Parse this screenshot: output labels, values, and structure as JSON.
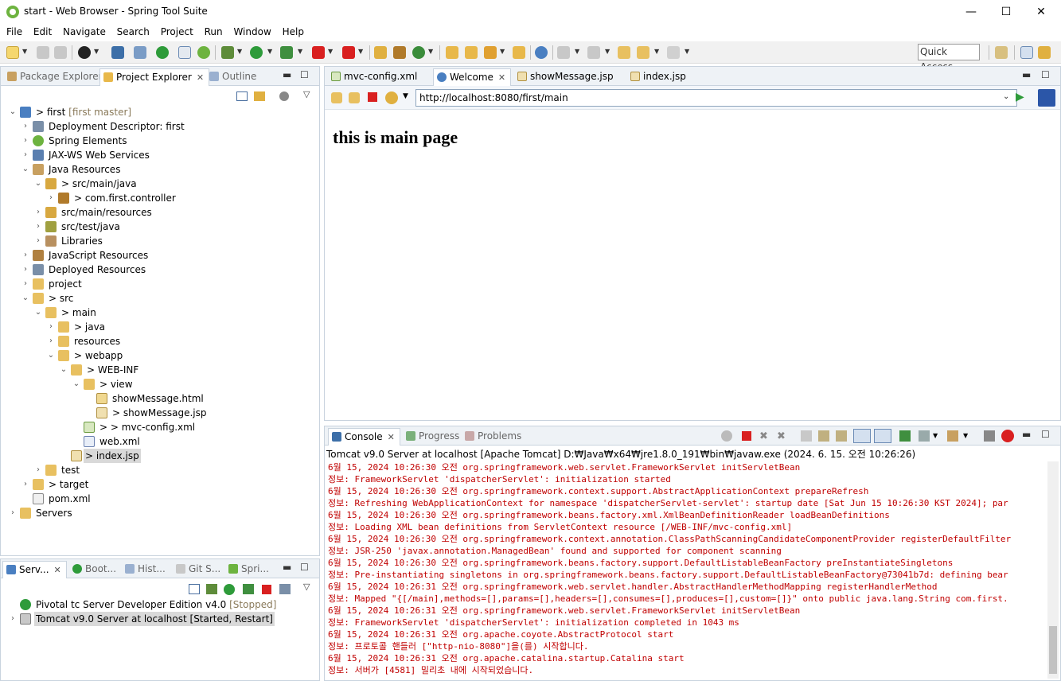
{
  "window": {
    "title": "start - Web Browser - Spring Tool Suite",
    "minimize": "—",
    "maximize": "☐",
    "close": "✕"
  },
  "menu": [
    "File",
    "Edit",
    "Navigate",
    "Search",
    "Project",
    "Run",
    "Window",
    "Help"
  ],
  "toolbar": {
    "quick_access_placeholder": "Quick Access"
  },
  "explorer": {
    "tabs": [
      {
        "label": "Package Explorer"
      },
      {
        "label": "Project Explorer",
        "close": "✕"
      },
      {
        "label": "Outline"
      }
    ],
    "tree": [
      {
        "twisty": "⌄",
        "prefix": "> ",
        "label": "first",
        "suffix": "[first master]"
      },
      {
        "twisty": "›",
        "label": "Deployment Descriptor: first"
      },
      {
        "twisty": "›",
        "label": "Spring Elements"
      },
      {
        "twisty": "›",
        "label": "JAX-WS Web Services"
      },
      {
        "twisty": "⌄",
        "label": "Java Resources"
      },
      {
        "twisty": "⌄",
        "prefix": "> ",
        "label": "src/main/java"
      },
      {
        "twisty": "›",
        "prefix": "> ",
        "label": "com.first.controller"
      },
      {
        "twisty": "›",
        "label": "src/main/resources"
      },
      {
        "twisty": "›",
        "label": "src/test/java"
      },
      {
        "twisty": "›",
        "label": "Libraries"
      },
      {
        "twisty": "›",
        "label": "JavaScript Resources"
      },
      {
        "twisty": "›",
        "label": "Deployed Resources"
      },
      {
        "twisty": "›",
        "label": "project"
      },
      {
        "twisty": "⌄",
        "prefix": "> ",
        "label": "src"
      },
      {
        "twisty": "⌄",
        "prefix": "> ",
        "label": "main"
      },
      {
        "twisty": "›",
        "prefix": "> ",
        "label": "java"
      },
      {
        "twisty": "›",
        "label": "resources"
      },
      {
        "twisty": "⌄",
        "prefix": "> ",
        "label": "webapp"
      },
      {
        "twisty": "⌄",
        "prefix": "> ",
        "label": "WEB-INF"
      },
      {
        "twisty": "⌄",
        "prefix": "> ",
        "label": "view"
      },
      {
        "twisty": "",
        "label": "showMessage.html"
      },
      {
        "twisty": "",
        "prefix": "> ",
        "label": "showMessage.jsp"
      },
      {
        "twisty": "",
        "prefix": "> > ",
        "label": "mvc-config.xml"
      },
      {
        "twisty": "",
        "label": "web.xml"
      },
      {
        "twisty": "",
        "prefix": "> ",
        "label": "index.jsp"
      },
      {
        "twisty": "›",
        "label": "test"
      },
      {
        "twisty": "›",
        "prefix": "> ",
        "label": "target"
      },
      {
        "twisty": "",
        "label": "pom.xml"
      },
      {
        "twisty": "›",
        "label": "Servers"
      }
    ]
  },
  "servers": {
    "tabs": [
      {
        "label": "Serv...",
        "close": "✕"
      },
      {
        "label": "Boot..."
      },
      {
        "label": "Hist..."
      },
      {
        "label": "Git S..."
      },
      {
        "label": "Spri..."
      }
    ],
    "items": [
      {
        "label": "Pivotal tc Server Developer Edition v4.0",
        "status": "[Stopped]"
      },
      {
        "twisty": "›",
        "label": "Tomcat v9.0 Server at localhost  [Started, Restart]"
      }
    ]
  },
  "editor": {
    "tabs": [
      {
        "label": "mvc-config.xml"
      },
      {
        "label": "Welcome",
        "close": "✕"
      },
      {
        "label": "showMessage.jsp"
      },
      {
        "label": "index.jsp"
      }
    ],
    "browser": {
      "url": "http://localhost:8080/first/main",
      "heading": "this is main page"
    }
  },
  "console": {
    "tabs": [
      {
        "label": "Console",
        "close": "✕"
      },
      {
        "label": "Progress"
      },
      {
        "label": "Problems"
      }
    ],
    "caption": "Tomcat v9.0 Server at localhost [Apache Tomcat] D:₩Java₩x64₩jre1.8.0_191₩bin₩javaw.exe (2024. 6. 15. 오전 10:26:26)",
    "lines": [
      "6월 15, 2024 10:26:30 오전 org.springframework.web.servlet.FrameworkServlet initServletBean",
      "정보: FrameworkServlet 'dispatcherServlet': initialization started",
      "6월 15, 2024 10:26:30 오전 org.springframework.context.support.AbstractApplicationContext prepareRefresh",
      "정보: Refreshing WebApplicationContext for namespace 'dispatcherServlet-servlet': startup date [Sat Jun 15 10:26:30 KST 2024]; par",
      "6월 15, 2024 10:26:30 오전 org.springframework.beans.factory.xml.XmlBeanDefinitionReader loadBeanDefinitions",
      "정보: Loading XML bean definitions from ServletContext resource [/WEB-INF/mvc-config.xml]",
      "6월 15, 2024 10:26:30 오전 org.springframework.context.annotation.ClassPathScanningCandidateComponentProvider registerDefaultFilter",
      "정보: JSR-250 'javax.annotation.ManagedBean' found and supported for component scanning",
      "6월 15, 2024 10:26:30 오전 org.springframework.beans.factory.support.DefaultListableBeanFactory preInstantiateSingletons",
      "정보: Pre-instantiating singletons in org.springframework.beans.factory.support.DefaultListableBeanFactory@73041b7d: defining bear",
      "6월 15, 2024 10:26:31 오전 org.springframework.web.servlet.handler.AbstractHandlerMethodMapping registerHandlerMethod",
      "정보: Mapped \"{[/main],methods=[],params=[],headers=[],consumes=[],produces=[],custom=[]}\" onto public java.lang.String com.first.",
      "6월 15, 2024 10:26:31 오전 org.springframework.web.servlet.FrameworkServlet initServletBean",
      "정보: FrameworkServlet 'dispatcherServlet': initialization completed in 1043 ms",
      "6월 15, 2024 10:26:31 오전 org.apache.coyote.AbstractProtocol start",
      "정보: 프로토콜 핸들러 [\"http-nio-8080\"]을(를) 시작합니다.",
      "6월 15, 2024 10:26:31 오전 org.apache.catalina.startup.Catalina start",
      "정보: 서버가 [4581] 밀리초 내에 시작되었습니다."
    ]
  },
  "colors": {
    "log_text": "#c00000",
    "spring_green": "#6db33f",
    "status_brown": "#8a7a5a"
  }
}
